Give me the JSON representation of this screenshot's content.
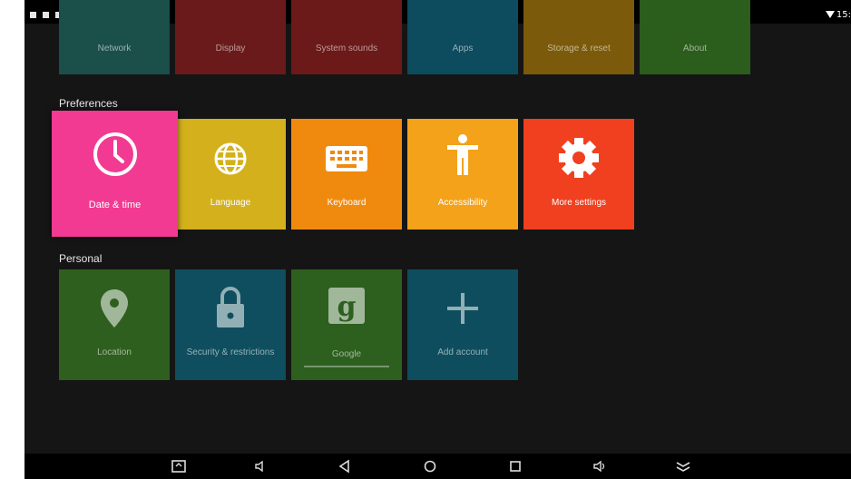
{
  "status_bar": {
    "time": "15:",
    "notification_icons": [
      "screen-icon",
      "photo-icon",
      "bag-icon",
      "bag-icon",
      "image-icon"
    ]
  },
  "top_row": {
    "tiles": [
      {
        "label": "Network",
        "color": "#1a4f4a"
      },
      {
        "label": "Display",
        "color": "#6a1a1a"
      },
      {
        "label": "System sounds",
        "color": "#6b1919"
      },
      {
        "label": "Apps",
        "color": "#0d4b5e"
      },
      {
        "label": "Storage & reset",
        "color": "#7b5a0b"
      },
      {
        "label": "About",
        "color": "#2b5d1c"
      }
    ]
  },
  "preferences": {
    "heading": "Preferences",
    "tiles": [
      {
        "label": "Date & time",
        "icon": "clock-icon",
        "color": "#f23a92"
      },
      {
        "label": "Language",
        "icon": "globe-icon",
        "color": "#d4b11c"
      },
      {
        "label": "Keyboard",
        "icon": "keyboard-icon",
        "color": "#f08a0f"
      },
      {
        "label": "Accessibility",
        "icon": "accessibility-icon",
        "color": "#f3a21a"
      },
      {
        "label": "More settings",
        "icon": "gear-icon",
        "color": "#f0401f"
      }
    ]
  },
  "personal": {
    "heading": "Personal",
    "tiles": [
      {
        "label": "Location",
        "icon": "location-pin-icon",
        "color": "#2e5f1f"
      },
      {
        "label": "Security & restrictions",
        "icon": "lock-icon",
        "color": "#0f4e5e"
      },
      {
        "label": "Google",
        "icon": "google-g-icon",
        "color": "#2d5f1f"
      },
      {
        "label": "Add account",
        "icon": "plus-icon",
        "color": "#0e4d5e"
      }
    ]
  },
  "nav_bar": {
    "buttons": [
      "screenshot-icon",
      "volume-down-icon",
      "back-icon",
      "home-icon",
      "recents-icon",
      "volume-up-icon",
      "hide-bar-icon"
    ]
  }
}
